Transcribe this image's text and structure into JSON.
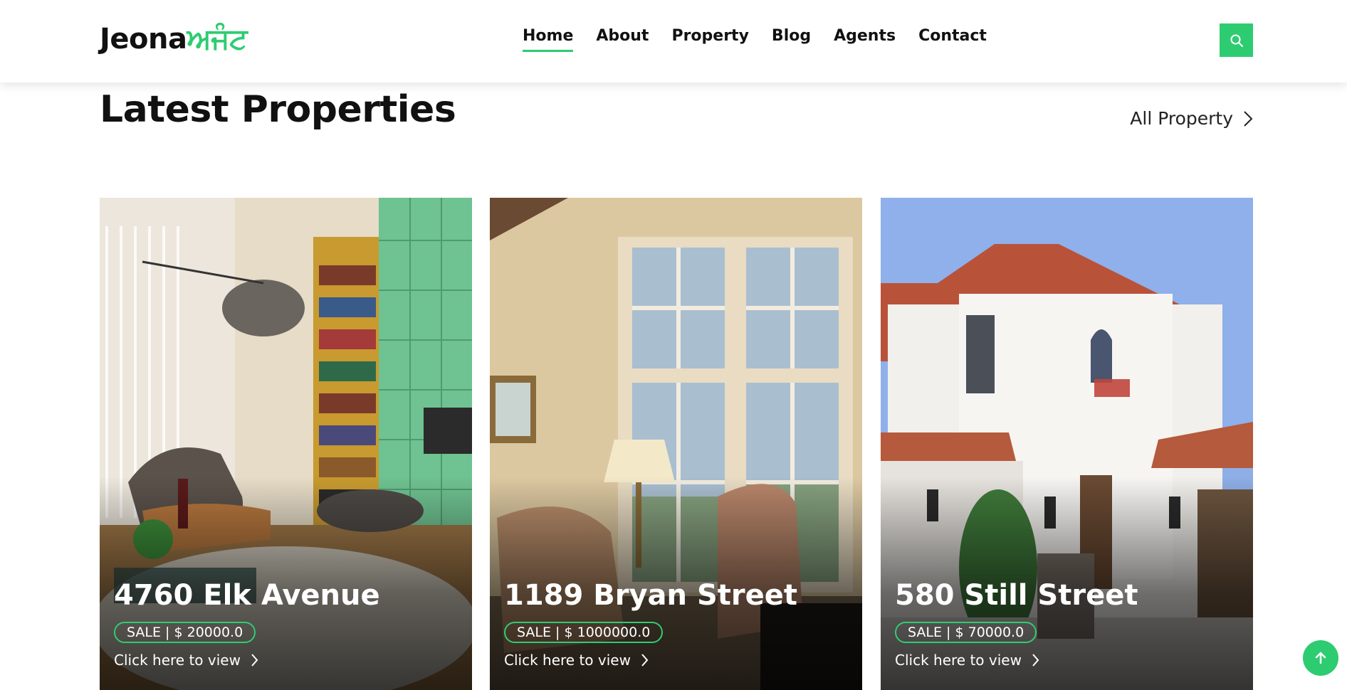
{
  "header": {
    "logo_main": "Jeona",
    "logo_accent": "ਅਜੰਟ",
    "nav": [
      "Home",
      "About",
      "Property",
      "Blog",
      "Agents",
      "Contact"
    ],
    "search_icon": "search-icon"
  },
  "section": {
    "title": "Latest Properties",
    "all_link": "All Property"
  },
  "cards": [
    {
      "name": "4760 Elk Avenue",
      "badge": "SALE | $ 20000.0",
      "link": "Click here to view"
    },
    {
      "name": "1189 Bryan Street",
      "badge": "SALE | $ 1000000.0",
      "link": "Click here to view"
    },
    {
      "name": "580 Still Street",
      "badge": "SALE | $ 70000.0",
      "link": "Click here to view"
    }
  ],
  "colors": {
    "accent": "#2ecc71"
  }
}
